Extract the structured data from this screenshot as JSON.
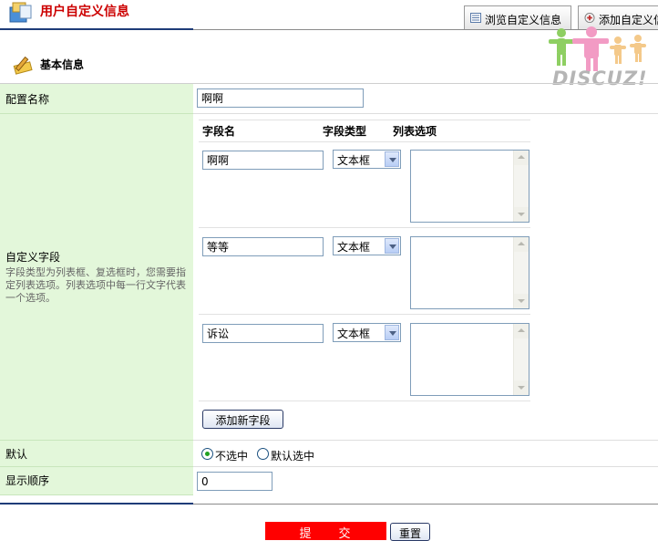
{
  "header": {
    "title": "用户自定义信息",
    "tabs": [
      {
        "label": "浏览自定义信息"
      },
      {
        "label": "添加自定义信息"
      }
    ]
  },
  "logo": {
    "text": "DISCUZ!"
  },
  "section": {
    "title": "基本信息"
  },
  "config_name": {
    "label": "配置名称",
    "value": "啊啊"
  },
  "custom_fields": {
    "label": "自定义字段",
    "hint": "字段类型为列表框、复选框时，您需要指定列表选项。列表选项中每一行文字代表一个选项。",
    "columns": {
      "name": "字段名",
      "type": "字段类型",
      "options": "列表选项"
    },
    "fields": [
      {
        "name": "啊啊",
        "type": "文本框"
      },
      {
        "name": "等等",
        "type": "文本框"
      },
      {
        "name": "诉讼",
        "type": "文本框"
      }
    ],
    "add_button": "添加新字段"
  },
  "default": {
    "label": "默认",
    "options": [
      {
        "label": "不选中",
        "selected": true
      },
      {
        "label": "默认选中",
        "selected": false
      }
    ]
  },
  "order": {
    "label": "显示顺序",
    "value": "0"
  },
  "buttons": {
    "submit": "提交",
    "reset": "重置"
  },
  "colors": {
    "title": "#cc0000",
    "label_bg": "#e3f7da",
    "accent_line": "#1e3c78",
    "submit_bg": "#ff0000"
  }
}
